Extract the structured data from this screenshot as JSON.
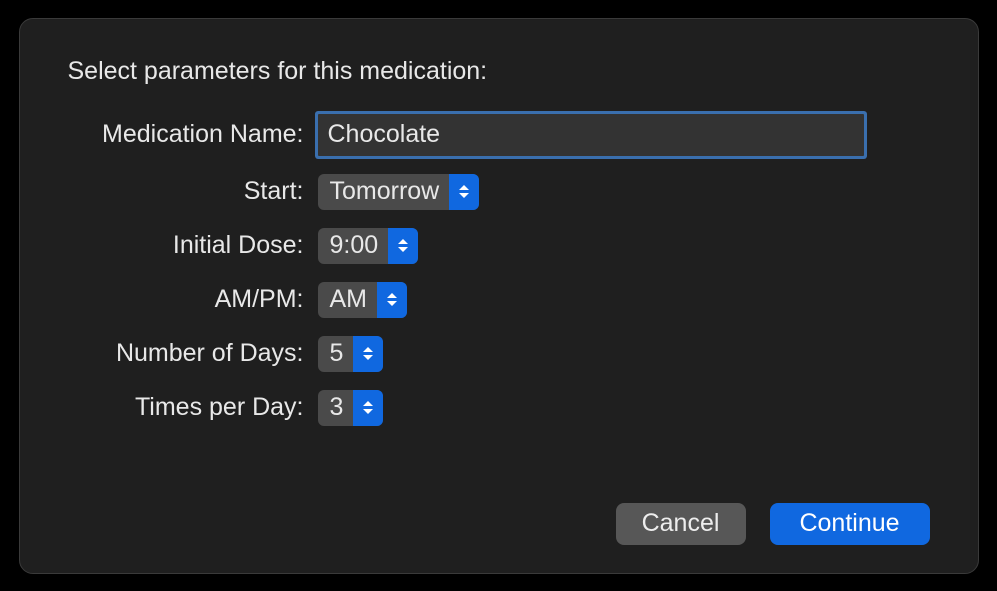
{
  "dialog": {
    "title": "Select parameters for this medication:",
    "fields": {
      "medication_name": {
        "label": "Medication Name:",
        "value": "Chocolate"
      },
      "start": {
        "label": "Start:",
        "value": "Tomorrow"
      },
      "initial_dose": {
        "label": "Initial Dose:",
        "value": "9:00"
      },
      "am_pm": {
        "label": "AM/PM:",
        "value": "AM"
      },
      "number_of_days": {
        "label": "Number of Days:",
        "value": "5"
      },
      "times_per_day": {
        "label": "Times per Day:",
        "value": "3"
      }
    },
    "buttons": {
      "cancel": "Cancel",
      "continue": "Continue"
    }
  }
}
